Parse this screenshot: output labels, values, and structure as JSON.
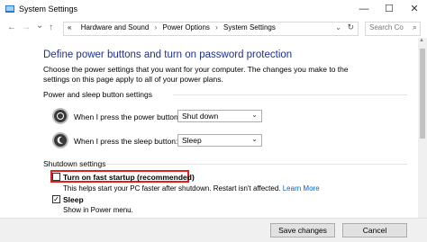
{
  "window": {
    "title": "System Settings",
    "minimize": "—",
    "maximize": "☐",
    "close": "✕"
  },
  "nav": {
    "back": "←",
    "forward": "→",
    "recent": "⌄",
    "up": "↑",
    "icon": "«"
  },
  "address": {
    "crumbs": [
      "Hardware and Sound",
      "Power Options",
      "System Settings"
    ],
    "separator": "›",
    "dropdown": "⌄",
    "refresh": "↻"
  },
  "search": {
    "placeholder": "Search Co",
    "icon": "⌕"
  },
  "page": {
    "heading": "Define power buttons and turn on password protection",
    "intro": "Choose the power settings that you want for your computer. The changes you make to the settings on this page apply to all of your power plans."
  },
  "power_section": {
    "title": "Power and sleep button settings",
    "power_button": {
      "label": "When I press the power button:",
      "value": "Shut down",
      "icon": "power-icon"
    },
    "sleep_button": {
      "label": "When I press the sleep button:",
      "value": "Sleep",
      "icon": "sleep-moon-icon"
    }
  },
  "shutdown_section": {
    "title": "Shutdown settings",
    "fast_startup": {
      "label": "Turn on fast startup (recommended)",
      "checked": false,
      "desc": "This helps start your PC faster after shutdown. Restart isn't affected.",
      "link": "Learn More"
    },
    "sleep": {
      "label": "Sleep",
      "checked": true,
      "desc": "Show in Power menu."
    }
  },
  "footer": {
    "save": "Save changes",
    "cancel": "Cancel"
  },
  "colors": {
    "heading": "#1e3287",
    "link": "#0066cc",
    "highlight": "#e02020"
  }
}
